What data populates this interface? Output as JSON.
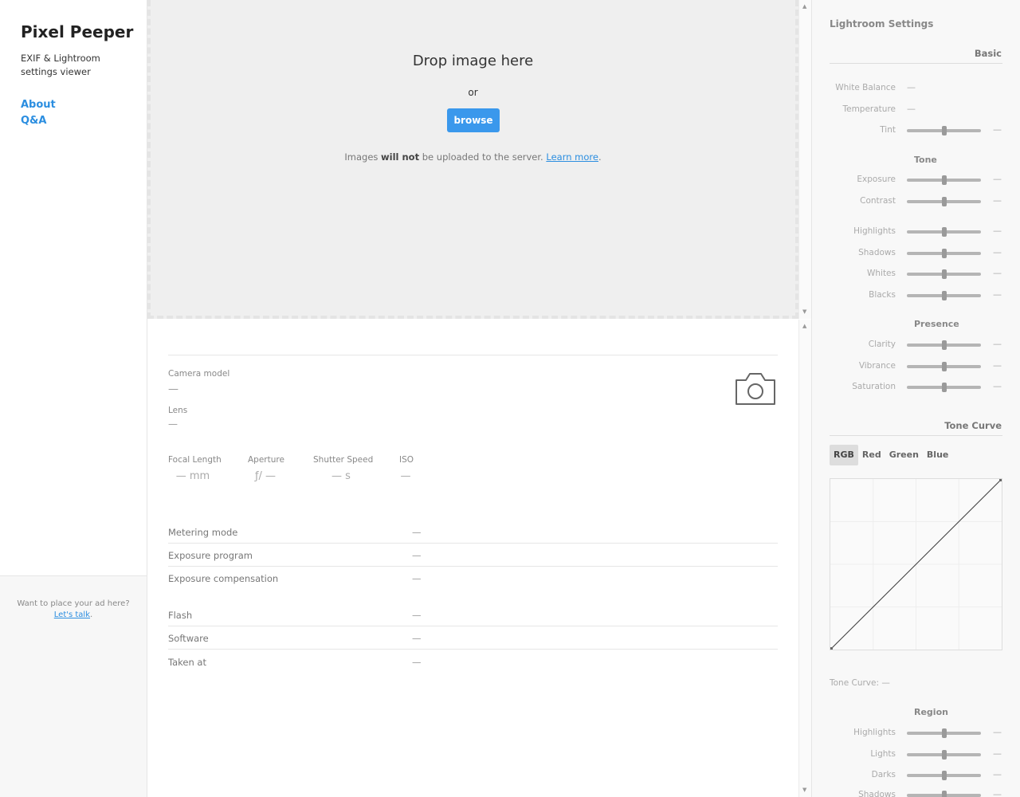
{
  "sidebar": {
    "brand": "Pixel Peeper",
    "tagline": "EXIF & Lightroom settings viewer",
    "nav": [
      {
        "label": "About"
      },
      {
        "label": "Q&A"
      }
    ],
    "ad": {
      "text": "Want to place your ad here?",
      "link": "Let's talk",
      "suffix": "."
    }
  },
  "dropzone": {
    "title": "Drop image here",
    "or": "or",
    "browse_label": "browse",
    "note_before": "Images ",
    "note_bold": "will not",
    "note_after": " be uploaded to the server. ",
    "note_link": "Learn more",
    "note_end": "."
  },
  "exif": {
    "camera_model_label": "Camera model",
    "camera_model_value": "—",
    "lens_label": "Lens",
    "lens_value": "—",
    "metrics": [
      {
        "label": "Focal Length",
        "value": "— mm"
      },
      {
        "label": "Aperture",
        "value": "ƒ/ —"
      },
      {
        "label": "Shutter Speed",
        "value": "— s"
      },
      {
        "label": "ISO",
        "value": "—"
      }
    ],
    "rows": [
      {
        "label": "Metering mode",
        "value": "—"
      },
      {
        "label": "Exposure program",
        "value": "—"
      },
      {
        "label": "Exposure compensation",
        "value": "—"
      },
      {
        "label": "Flash",
        "value": "—"
      },
      {
        "label": "Software",
        "value": "—"
      },
      {
        "label": "Taken at",
        "value": "—"
      }
    ]
  },
  "lightroom": {
    "title": "Lightroom Settings",
    "basic": {
      "heading": "Basic",
      "white_balance": {
        "label": "White Balance",
        "value": "—"
      },
      "temperature": {
        "label": "Temperature",
        "value": "—"
      },
      "tint": {
        "label": "Tint",
        "value": "—",
        "level": 0.5
      },
      "tone_heading": "Tone",
      "tone": [
        {
          "label": "Exposure",
          "value": "—",
          "level": 0.5
        },
        {
          "label": "Contrast",
          "value": "—",
          "level": 0.5
        },
        {
          "label": "Highlights",
          "value": "—",
          "level": 0.5
        },
        {
          "label": "Shadows",
          "value": "—",
          "level": 0.5
        },
        {
          "label": "Whites",
          "value": "—",
          "level": 0.5
        },
        {
          "label": "Blacks",
          "value": "—",
          "level": 0.5
        }
      ],
      "presence_heading": "Presence",
      "presence": [
        {
          "label": "Clarity",
          "value": "—",
          "level": 0.5
        },
        {
          "label": "Vibrance",
          "value": "—",
          "level": 0.5
        },
        {
          "label": "Saturation",
          "value": "—",
          "level": 0.5
        }
      ]
    },
    "tone_curve": {
      "heading": "Tone Curve",
      "tabs": [
        {
          "label": "RGB",
          "active": true
        },
        {
          "label": "Red",
          "active": false
        },
        {
          "label": "Green",
          "active": false
        },
        {
          "label": "Blue",
          "active": false
        }
      ],
      "status_label": "Tone Curve: —",
      "region_heading": "Region",
      "region": [
        {
          "label": "Highlights",
          "value": "—",
          "level": 0.5
        },
        {
          "label": "Lights",
          "value": "—",
          "level": 0.5
        },
        {
          "label": "Darks",
          "value": "—",
          "level": 0.5
        },
        {
          "label": "Shadows",
          "value": "—",
          "level": 0.5
        }
      ]
    }
  },
  "colors": {
    "accent": "#3a98ec",
    "link": "#2b8ee0"
  }
}
